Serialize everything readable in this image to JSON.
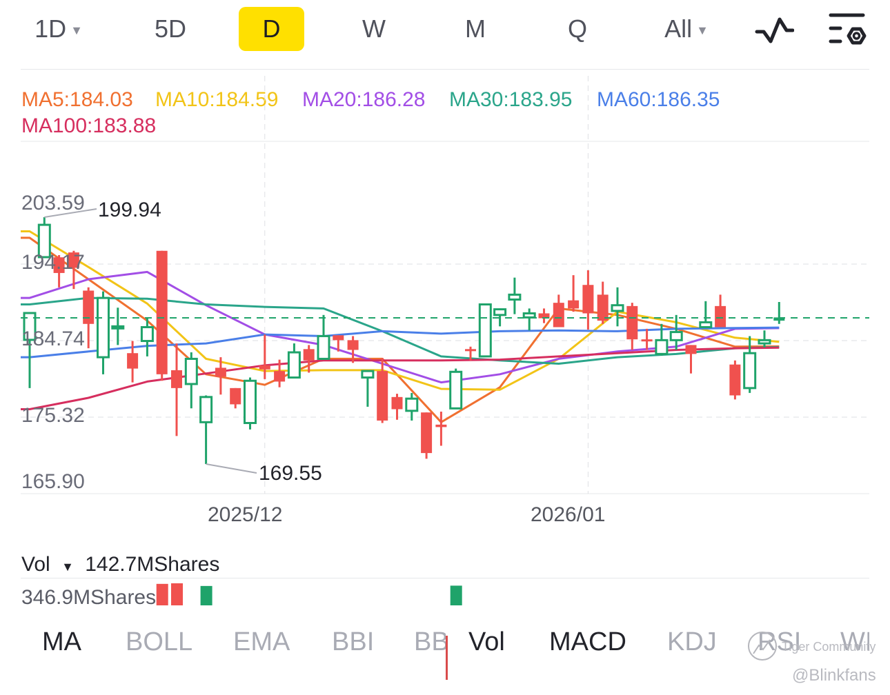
{
  "toolbar": {
    "timeframes": [
      {
        "label": "1D",
        "dropdown": true
      },
      {
        "label": "5D"
      },
      {
        "label": "D",
        "active": true
      },
      {
        "label": "W"
      },
      {
        "label": "M"
      },
      {
        "label": "Q"
      },
      {
        "label": "All",
        "dropdown": true
      }
    ],
    "icons": [
      "line-chart-icon",
      "indicator-settings-icon"
    ],
    "active_color": "#FFE000"
  },
  "ma_legend": [
    {
      "label": "MA5:184.03",
      "color": "#F07030"
    },
    {
      "label": "MA10:184.59",
      "color": "#F2C417"
    },
    {
      "label": "MA20:186.28",
      "color": "#A24EE6"
    },
    {
      "label": "MA30:183.95",
      "color": "#2AA58A"
    },
    {
      "label": "MA60:186.35",
      "color": "#4A7FE8"
    },
    {
      "label": "MA100:183.88",
      "color": "#D62E5E"
    }
  ],
  "chart_data": {
    "type": "candlestick",
    "ylim": [
      165.9,
      203.59
    ],
    "y_ticks": [
      "203.59",
      "194.17",
      "184.74",
      "175.32",
      "165.90"
    ],
    "x_ticks": [
      {
        "label": "2025/12",
        "index": 16
      },
      {
        "label": "2026/01",
        "index": 38
      }
    ],
    "grid": true,
    "current_price": 187.55,
    "up_color": "#1FA36A",
    "down_color": "#F0514E",
    "high_annotation": {
      "label": "199.94",
      "index": 1,
      "value": 199.94
    },
    "low_annotation": {
      "label": "169.55",
      "index": 12,
      "value": 169.55
    },
    "candles_ohlc": [
      [
        184.84,
        188.14,
        178.9,
        188.14
      ],
      [
        195.02,
        199.94,
        195.02,
        199.0
      ],
      [
        195.0,
        195.27,
        191.3,
        193.07
      ],
      [
        195.6,
        195.8,
        191.1,
        193.7
      ],
      [
        190.9,
        191.3,
        183.8,
        186.8
      ],
      [
        182.7,
        190.8,
        180.6,
        190.0
      ],
      [
        186.3,
        188.8,
        184.2,
        186.5
      ],
      [
        183.2,
        184.7,
        179.6,
        181.3
      ],
      [
        184.7,
        187.6,
        182.8,
        186.4
      ],
      [
        195.8,
        195.8,
        179.8,
        180.6
      ],
      [
        181.1,
        184.4,
        173.0,
        178.9
      ],
      [
        179.4,
        183.3,
        176.4,
        182.5
      ],
      [
        174.7,
        178.0,
        169.55,
        177.8
      ],
      [
        181.4,
        182.7,
        178.1,
        180.3
      ],
      [
        178.9,
        178.9,
        176.4,
        176.9
      ],
      [
        174.6,
        180.2,
        173.8,
        179.8
      ],
      [
        181.7,
        185.5,
        180.0,
        181.2
      ],
      [
        181.0,
        182.4,
        179.0,
        179.7
      ],
      [
        180.2,
        184.4,
        180.2,
        183.3
      ],
      [
        183.7,
        184.2,
        180.8,
        182.3
      ],
      [
        182.5,
        187.9,
        182.5,
        185.3
      ],
      [
        185.4,
        185.4,
        183.4,
        184.8
      ],
      [
        184.8,
        185.3,
        182.0,
        183.6
      ],
      [
        180.2,
        181.1,
        176.6,
        181.0
      ],
      [
        181.0,
        182.6,
        174.6,
        174.9
      ],
      [
        177.8,
        178.2,
        175.0,
        176.3
      ],
      [
        176.1,
        178.3,
        174.9,
        177.6
      ],
      [
        175.9,
        175.9,
        170.2,
        170.9
      ],
      [
        174.4,
        176.0,
        171.8,
        174.1
      ],
      [
        176.4,
        181.3,
        176.4,
        180.9
      ],
      [
        183.7,
        184.0,
        182.3,
        183.6
      ],
      [
        182.8,
        189.2,
        182.8,
        189.2
      ],
      [
        187.9,
        188.7,
        186.5,
        188.6
      ],
      [
        189.8,
        192.5,
        188.0,
        190.4
      ],
      [
        187.6,
        188.7,
        186.0,
        188.1
      ],
      [
        188.1,
        188.7,
        186.9,
        187.5
      ],
      [
        189.4,
        190.4,
        186.4,
        186.4
      ],
      [
        189.7,
        192.8,
        188.3,
        188.7
      ],
      [
        191.6,
        193.4,
        186.1,
        188.1
      ],
      [
        190.4,
        192.0,
        186.8,
        187.2
      ],
      [
        188.4,
        191.3,
        186.5,
        189.1
      ],
      [
        189.0,
        189.4,
        183.6,
        184.9
      ],
      [
        184.9,
        186.2,
        183.6,
        184.8
      ],
      [
        183.1,
        186.8,
        182.9,
        184.8
      ],
      [
        184.8,
        187.9,
        183.6,
        185.8
      ],
      [
        184.2,
        184.2,
        180.7,
        183.1
      ],
      [
        186.4,
        189.6,
        186.4,
        187.0
      ],
      [
        189.0,
        190.4,
        186.4,
        186.4
      ],
      [
        181.8,
        182.3,
        177.5,
        178.0
      ],
      [
        178.9,
        185.3,
        178.3,
        183.2
      ],
      [
        184.4,
        186.0,
        183.9,
        184.8
      ],
      [
        187.2,
        189.5,
        186.8,
        187.6
      ]
    ],
    "ma_series": {
      "x_index": [
        0,
        4,
        8,
        12,
        16,
        20,
        24,
        28,
        32,
        36,
        40,
        44,
        48,
        51
      ],
      "lines": [
        {
          "name": "MA5",
          "color": "#F07030",
          "values": [
            197.4,
            192.3,
            187.2,
            180.6,
            179.3,
            182.5,
            182.5,
            174.7,
            179.0,
            188.7,
            187.9,
            186.2,
            184.0,
            184.03
          ]
        },
        {
          "name": "MA10",
          "color": "#F2C417",
          "values": [
            198.2,
            193.8,
            189.3,
            182.5,
            181.0,
            181.1,
            181.1,
            178.8,
            178.7,
            182.5,
            188.3,
            187.0,
            185.1,
            184.59
          ]
        },
        {
          "name": "MA20",
          "color": "#A24EE6",
          "values": [
            190.0,
            192.3,
            193.2,
            189.1,
            185.5,
            184.2,
            181.9,
            179.6,
            180.6,
            182.5,
            183.4,
            184.0,
            186.2,
            186.28
          ]
        },
        {
          "name": "MA30",
          "color": "#2AA58A",
          "values": [
            189.2,
            190.0,
            189.9,
            189.2,
            188.9,
            188.7,
            185.9,
            182.8,
            182.3,
            181.9,
            182.7,
            183.1,
            183.8,
            183.95
          ]
        },
        {
          "name": "MA60",
          "color": "#4A7FE8",
          "values": [
            182.7,
            183.4,
            184.1,
            184.4,
            185.5,
            185.3,
            185.9,
            185.6,
            185.9,
            186.0,
            185.9,
            186.2,
            186.3,
            186.35
          ]
        },
        {
          "name": "MA100",
          "color": "#D62E5E",
          "values": [
            176.3,
            177.7,
            179.7,
            180.7,
            181.7,
            182.3,
            182.3,
            182.3,
            182.4,
            182.8,
            183.2,
            183.6,
            183.8,
            183.88
          ]
        }
      ]
    }
  },
  "volume": {
    "label": "Vol",
    "current": "142.7MShares",
    "max_label": "346.9MShares",
    "visible_bars": [
      {
        "index": 9,
        "value": 338,
        "dir": "down"
      },
      {
        "index": 10,
        "value": 346.9,
        "dir": "down"
      },
      {
        "index": 12,
        "value": 305,
        "dir": "up"
      },
      {
        "index": 29,
        "value": 310,
        "dir": "up"
      }
    ]
  },
  "indicators": {
    "main": [
      {
        "label": "MA",
        "active": true
      },
      {
        "label": "BOLL"
      },
      {
        "label": "EMA"
      },
      {
        "label": "BBI"
      },
      {
        "label": "BB"
      }
    ],
    "sub": [
      {
        "label": "Vol",
        "active": true
      },
      {
        "label": "MACD",
        "active": true
      },
      {
        "label": "KDJ"
      },
      {
        "label": "RSI"
      },
      {
        "label": "WI"
      }
    ]
  },
  "watermark": {
    "brand": "Tiger Community",
    "user": "@Blinkfans"
  }
}
